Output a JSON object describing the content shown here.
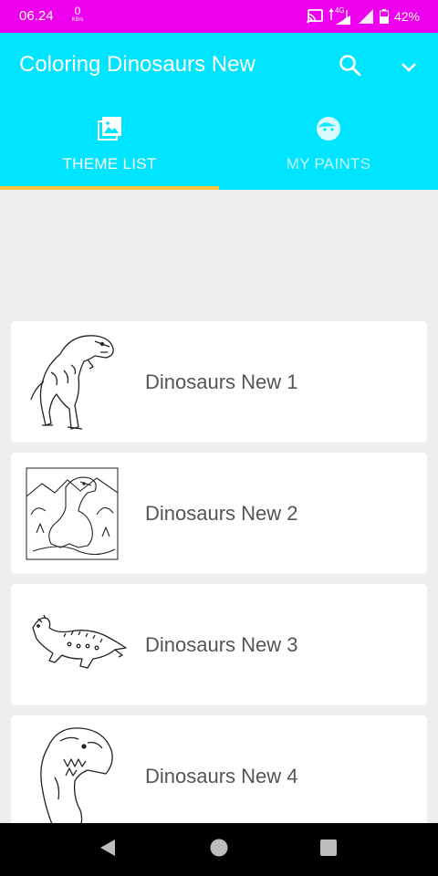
{
  "status_bar": {
    "time": "06.24",
    "net_speed_value": "0",
    "net_speed_unit": "KB/s",
    "network_type": "4G",
    "battery_percent": "42%"
  },
  "app_bar": {
    "title": "Coloring Dinosaurs New",
    "search_icon": "search-icon",
    "menu_icon": "chevron-down-icon",
    "background_color": "#00e5ff",
    "indicator_color": "#f5c542"
  },
  "tabs": [
    {
      "label": "THEME LIST",
      "icon": "image-icon",
      "selected": true
    },
    {
      "label": "MY PAINTS",
      "icon": "face-icon",
      "selected": false
    }
  ],
  "themes": [
    {
      "title": "Dinosaurs New 1",
      "thumbnail": "standing-dinosaur-icon"
    },
    {
      "title": "Dinosaurs New 2",
      "thumbnail": "dinosaur-landscape-icon"
    },
    {
      "title": "Dinosaurs New 3",
      "thumbnail": "armored-dinosaur-icon"
    },
    {
      "title": "Dinosaurs New 4",
      "thumbnail": "trex-head-icon"
    }
  ],
  "nav_bar": {
    "back_icon": "back-triangle-icon",
    "home_icon": "home-circle-icon",
    "recents_icon": "recents-square-icon"
  }
}
